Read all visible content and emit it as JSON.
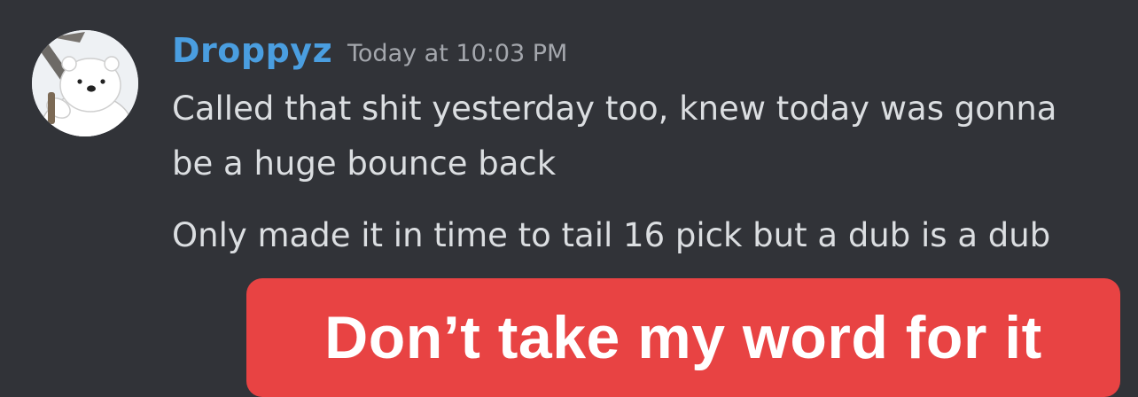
{
  "message": {
    "author": "Droppyz",
    "timestamp": "Today at 10:03 PM",
    "avatar_icon": "polar-bear-avatar",
    "lines": [
      "Called that shit yesterday too, knew today was gonna be a huge bounce back",
      "Only made it in time to tail 16 pick but a dub is a dub"
    ]
  },
  "overlay": {
    "caption": "Don’t take my word for it"
  },
  "colors": {
    "background": "#313338",
    "username": "#4a9ee0",
    "timestamp": "#a4a7ad",
    "message_text": "#dbdee1",
    "banner": "#e84343",
    "banner_text": "#ffffff"
  }
}
